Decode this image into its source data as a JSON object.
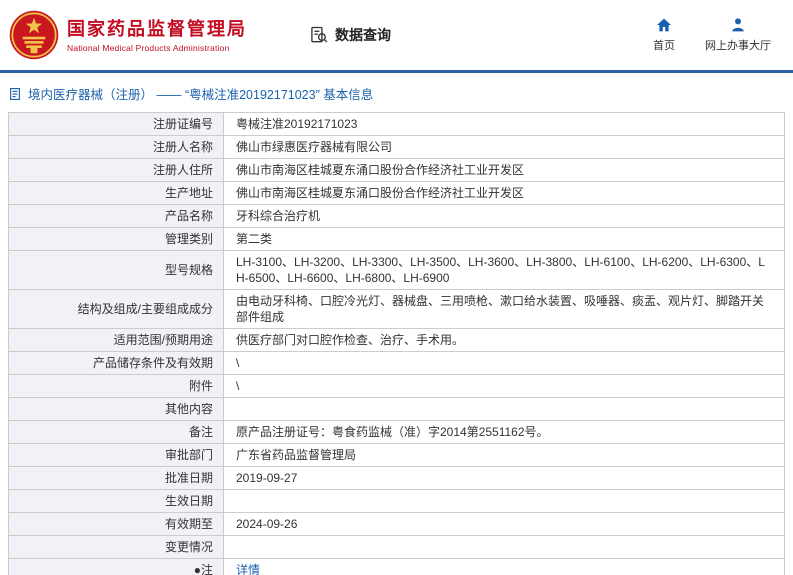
{
  "header": {
    "org_name_cn": "国家药品监督管理局",
    "org_name_en": "National Medical Products Administration",
    "section_title": "数据查询",
    "nav_home": "首页",
    "nav_hall": "网上办事大厅"
  },
  "breadcrumb": {
    "text": "境内医疗器械（注册） ——  “粤械注准20192171023”  基本信息"
  },
  "colors": {
    "brand_red": "#c30d23",
    "divider_blue": "#2c61a7",
    "link_blue": "#1b62ad",
    "label_bg": "#f1f1f7",
    "border_gray": "#cccccc"
  },
  "table": {
    "rows": [
      {
        "label": "注册证编号",
        "value": "粤械注准20192171023"
      },
      {
        "label": "注册人名称",
        "value": "佛山市绿惠医疗器械有限公司"
      },
      {
        "label": "注册人住所",
        "value": "佛山市南海区桂城夏东涌口股份合作经济社工业开发区"
      },
      {
        "label": "生产地址",
        "value": "佛山市南海区桂城夏东涌口股份合作经济社工业开发区"
      },
      {
        "label": "产品名称",
        "value": "牙科综合治疗机"
      },
      {
        "label": "管理类别",
        "value": "第二类"
      },
      {
        "label": "型号规格",
        "value": "LH-3100、LH-3200、LH-3300、LH-3500、LH-3600、LH-3800、LH-6100、LH-6200、LH-6300、LH-6500、LH-6600、LH-6800、LH-6900"
      },
      {
        "label": "结构及组成/主要组成成分",
        "value": "由电动牙科椅、口腔冷光灯、器械盘、三用喷枪、漱口给水装置、吸唾器、痰盂、观片灯、脚踏开关部件组成"
      },
      {
        "label": "适用范围/预期用途",
        "value": "供医疗部门对口腔作检查、治疗、手术用。"
      },
      {
        "label": "产品储存条件及有效期",
        "value": "\\"
      },
      {
        "label": "附件",
        "value": "\\"
      },
      {
        "label": "其他内容",
        "value": ""
      },
      {
        "label": "备注",
        "value": "原产品注册证号：粤食药监械（准）字2014第2551162号。"
      },
      {
        "label": "审批部门",
        "value": "广东省药品监督管理局"
      },
      {
        "label": "批准日期",
        "value": "2019-09-27"
      },
      {
        "label": "生效日期",
        "value": ""
      },
      {
        "label": "有效期至",
        "value": "2024-09-26"
      },
      {
        "label": "变更情况",
        "value": ""
      },
      {
        "label": "●注",
        "value": "详情",
        "link": true
      }
    ]
  }
}
